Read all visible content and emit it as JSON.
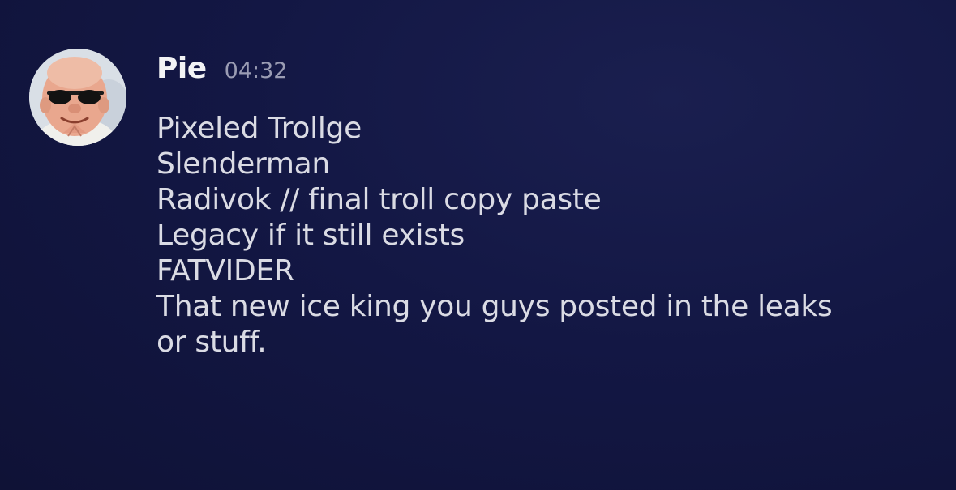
{
  "message": {
    "author": "Pie",
    "timestamp": "04:32",
    "avatar": "cartoon-man-sunglasses-avatar",
    "lines": [
      "Pixeled Trollge",
      "Slenderman",
      "Radivok // final troll copy paste",
      "Legacy if it still exists",
      "FATVIDER",
      "That new ice king you guys posted in the leaks",
      "or stuff."
    ]
  },
  "colors": {
    "background": "#131744",
    "username": "#f2f3f5",
    "timestamp": "#9a9cb3",
    "text": "#dadbe4"
  }
}
